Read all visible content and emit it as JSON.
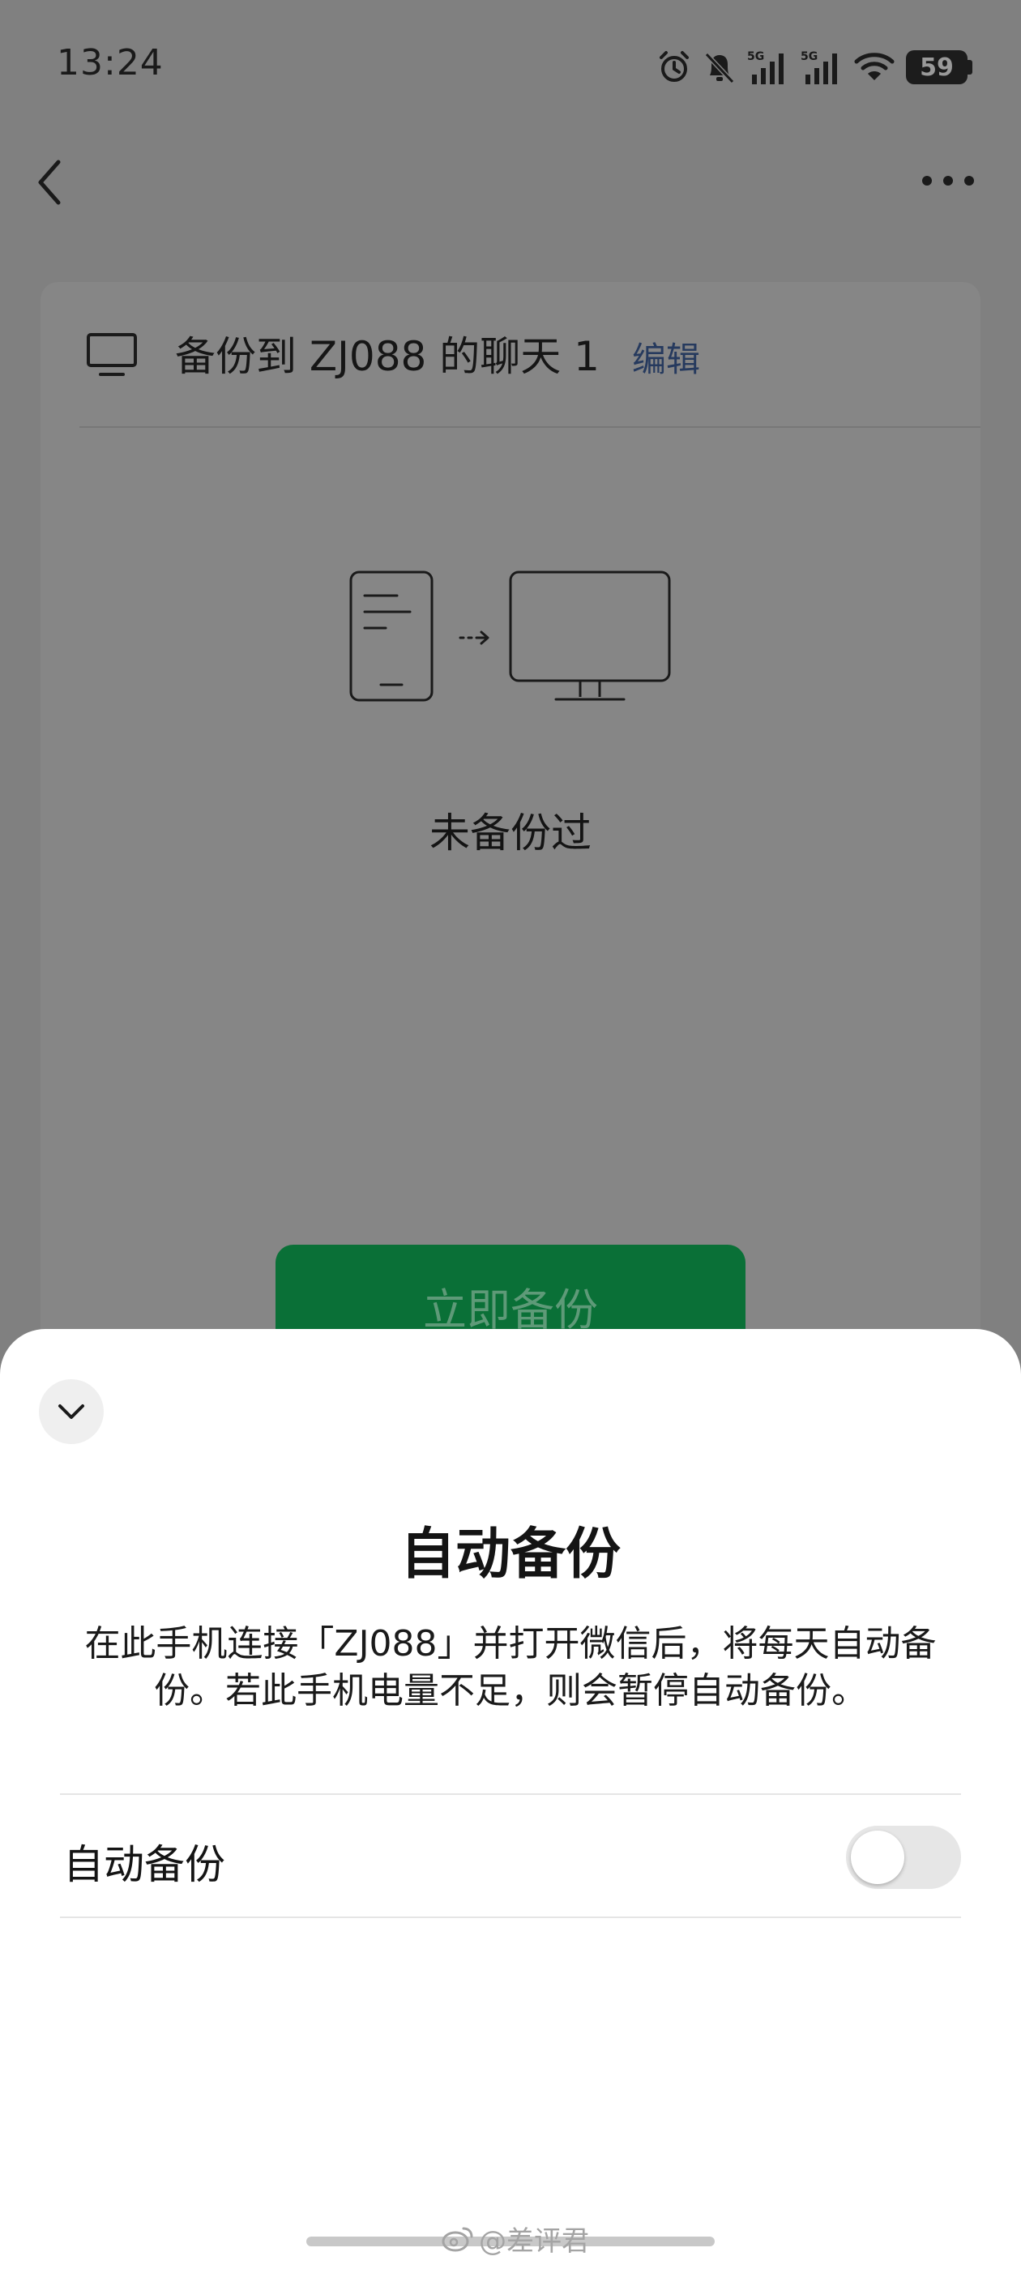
{
  "status_bar": {
    "time": "13:24",
    "signal_label_1": "5G",
    "signal_label_2": "5G",
    "battery_level": "59"
  },
  "card": {
    "title": "备份到 ZJ088 的聊天 1",
    "edit_label": "编辑",
    "status_text": "未备份过",
    "backup_button_label": "立即备份"
  },
  "sheet": {
    "title": "自动备份",
    "description": "在此手机连接「ZJ088」并打开微信后，将每天自动备份。若此手机电量不足，则会暂停自动备份。",
    "setting_label": "自动备份",
    "toggle_on": false
  },
  "watermark": {
    "text": "@差评君"
  },
  "icons": [
    "chevron-left-icon",
    "more-icon",
    "monitor-icon",
    "phone-icon",
    "arrow-right-icon",
    "chevron-down-icon",
    "alarm-icon",
    "bell-off-icon",
    "signal-icon",
    "wifi-icon",
    "battery-icon",
    "weibo-icon"
  ],
  "colors": {
    "overlay_bg": "#808080",
    "button_green": "#0a7037",
    "link_blue": "#263a5e",
    "sheet_bg": "#ffffff"
  }
}
